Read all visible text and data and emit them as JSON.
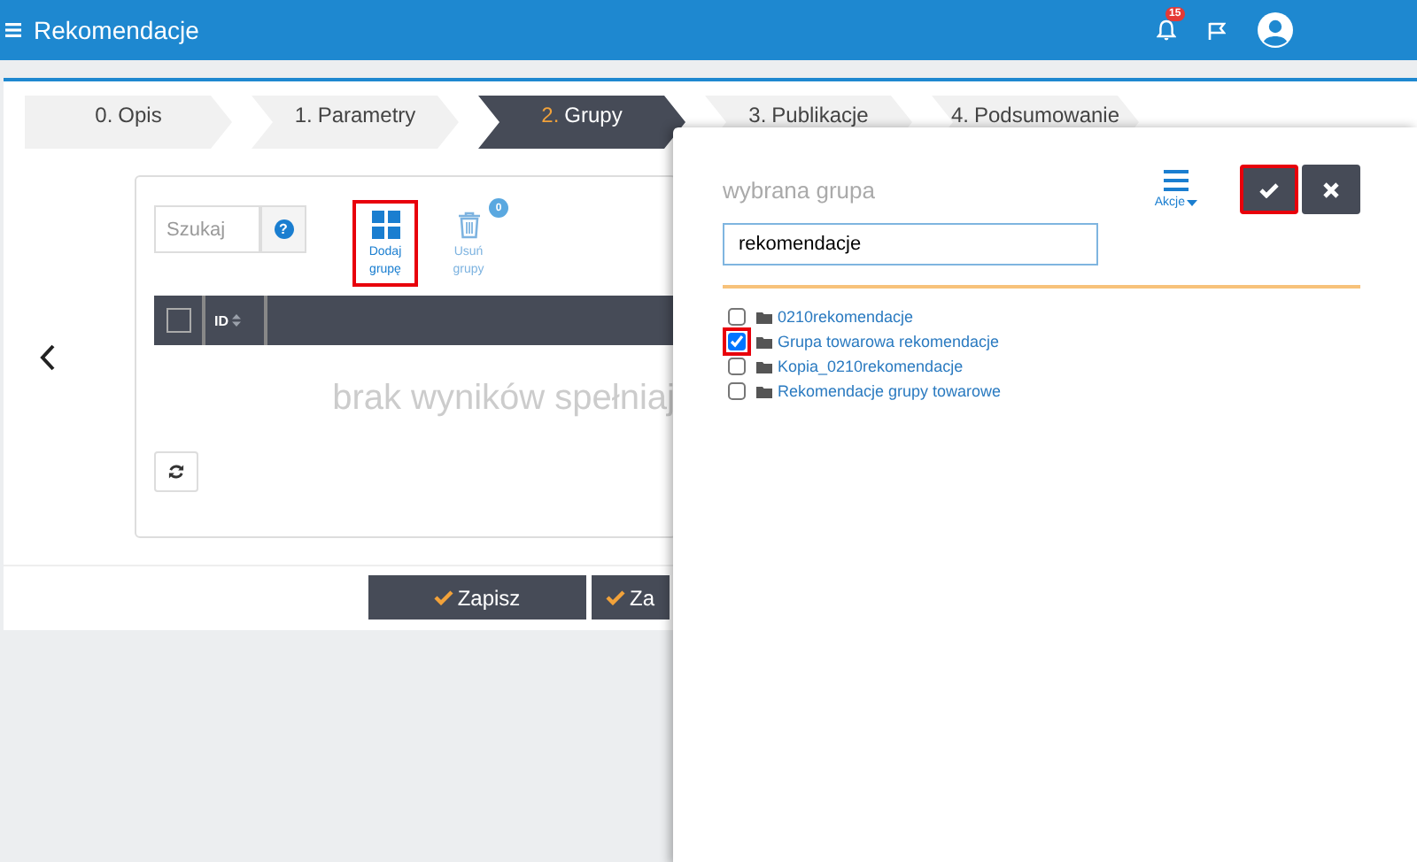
{
  "header": {
    "title": "Rekomendacje",
    "notifications_badge": "15"
  },
  "steps": [
    {
      "number": "0.",
      "label": "Opis",
      "selected": false
    },
    {
      "number": "1.",
      "label": "Parametry",
      "selected": false
    },
    {
      "number": "2.",
      "label": "Grupy",
      "selected": true
    },
    {
      "number": "3.",
      "label": "Publikacje",
      "selected": false
    },
    {
      "number": "4.",
      "label": "Podsumowanie",
      "selected": false
    }
  ],
  "toolbar": {
    "search": {
      "placeholder": "Szukaj",
      "help_label": "?"
    },
    "buttons": [
      {
        "kind": "add",
        "label": "Dodaj grupę",
        "highlighted": true,
        "disabled": false
      },
      {
        "kind": "delete",
        "label": "Usuń grupy",
        "highlighted": false,
        "disabled": true,
        "badge": "0"
      }
    ]
  },
  "table": {
    "select_all_checked": false,
    "columns": [
      {
        "label": "ID"
      }
    ],
    "empty_message": "brak wyników spełniaj"
  },
  "footer_buttons": [
    {
      "label": "Zapisz"
    },
    {
      "label": "Za"
    }
  ],
  "dialog": {
    "title": "wybrana grupa",
    "actions_label": "Akcje",
    "confirm_highlighted": true,
    "search": {
      "value": "rekomendacje"
    },
    "items": [
      {
        "label": "0210rekomendacje",
        "checked": false,
        "highlighted": false
      },
      {
        "label": "Grupa towarowa rekomendacje",
        "checked": true,
        "highlighted": true
      },
      {
        "label": "Kopia_0210rekomendacje",
        "checked": false,
        "highlighted": false
      },
      {
        "label": "Rekomendacje grupy towarowe",
        "checked": false,
        "highlighted": false
      }
    ]
  }
}
